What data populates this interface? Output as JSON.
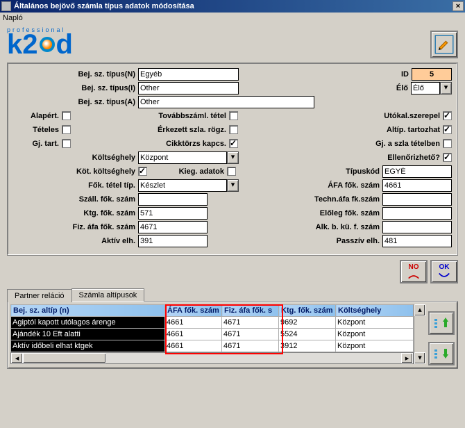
{
  "window": {
    "title": "Általános bejövő számla típus adatok módosítása",
    "menu_log": "Napló"
  },
  "logo": {
    "top": "professional",
    "brand": "k2d"
  },
  "form": {
    "bej_sz_tipus_n": {
      "label": "Bej. sz. típus(N)",
      "value": "Egyéb"
    },
    "bej_sz_tipus_i": {
      "label": "Bej. sz. típus(I)",
      "value": "Other"
    },
    "bej_sz_tipus_a": {
      "label": "Bej. sz. típus(A)",
      "value": "Other"
    },
    "id": {
      "label": "ID",
      "value": "5"
    },
    "elo": {
      "label": "Élő",
      "value": "Élő"
    },
    "alapert": {
      "label": "Alapért."
    },
    "tovabbszaml": {
      "label": "Továbbszáml. tétel"
    },
    "utokal": {
      "label": "Utókal.szerepel"
    },
    "teteles": {
      "label": "Tételes"
    },
    "erkezett": {
      "label": "Érkezett szla. rögz."
    },
    "altip_tartozhat": {
      "label": "Altíp. tartozhat"
    },
    "gj_tart": {
      "label": "Gj. tart."
    },
    "cikktorzs": {
      "label": "Cikktörzs kapcs."
    },
    "gj_szla": {
      "label": "Gj. a szla tételben"
    },
    "koltseghely": {
      "label": "Költséghely",
      "value": "Központ"
    },
    "ellenorizheto": {
      "label": "Ellenőrizhető?"
    },
    "kot_koltseghely": {
      "label": "Köt. költséghely"
    },
    "kieg_adatok": {
      "label": "Kieg. adatok"
    },
    "tipuskod": {
      "label": "Típuskód",
      "value": "EGYÉ"
    },
    "fok_tetel_tip": {
      "label": "Fők. tétel típ.",
      "value": "Készlet"
    },
    "afa_fok_szam": {
      "label": "ÁFA fők. szám",
      "value": "4661"
    },
    "szall_fok_szam": {
      "label": "Száll. fők. szám",
      "value": ""
    },
    "techn_afa": {
      "label": "Techn.áfa fk.szám",
      "value": ""
    },
    "ktg_fok_szam": {
      "label": "Ktg. fők. szám",
      "value": "571"
    },
    "eloleg_fok_szam": {
      "label": "Előleg fők. szám",
      "value": ""
    },
    "fiz_afa_fok_szam": {
      "label": "Fiz. áfa fők. szám",
      "value": "4671"
    },
    "alk_b_ku_f_szam": {
      "label": "Alk. b. kü. f. szám",
      "value": ""
    },
    "aktiv_elh": {
      "label": "Aktív elh.",
      "value": "391"
    },
    "passziv_elh": {
      "label": "Passzív elh.",
      "value": "481"
    }
  },
  "buttons": {
    "no": "NO",
    "ok": "OK"
  },
  "tabs": {
    "partner": "Partner reláció",
    "altipusok": "Számla altípusok"
  },
  "grid": {
    "headers": [
      "Bej. sz. altíp (n)",
      "ÁFA fők. szám",
      "Fiz. áfa fők. s",
      "Ktg. fők. szám",
      "Költséghely"
    ],
    "rows": [
      {
        "name": "Agiptól kapott utólagos árenge",
        "afa": "4661",
        "fiz": "4671",
        "ktg": "9692",
        "hely": "Központ"
      },
      {
        "name": "Ajándék 10 Eft alatti",
        "afa": "4661",
        "fiz": "4671",
        "ktg": "5524",
        "hely": "Központ"
      },
      {
        "name": "Aktív időbeli elhat ktgek",
        "afa": "4661",
        "fiz": "4671",
        "ktg": "3912",
        "hely": "Központ"
      }
    ]
  }
}
